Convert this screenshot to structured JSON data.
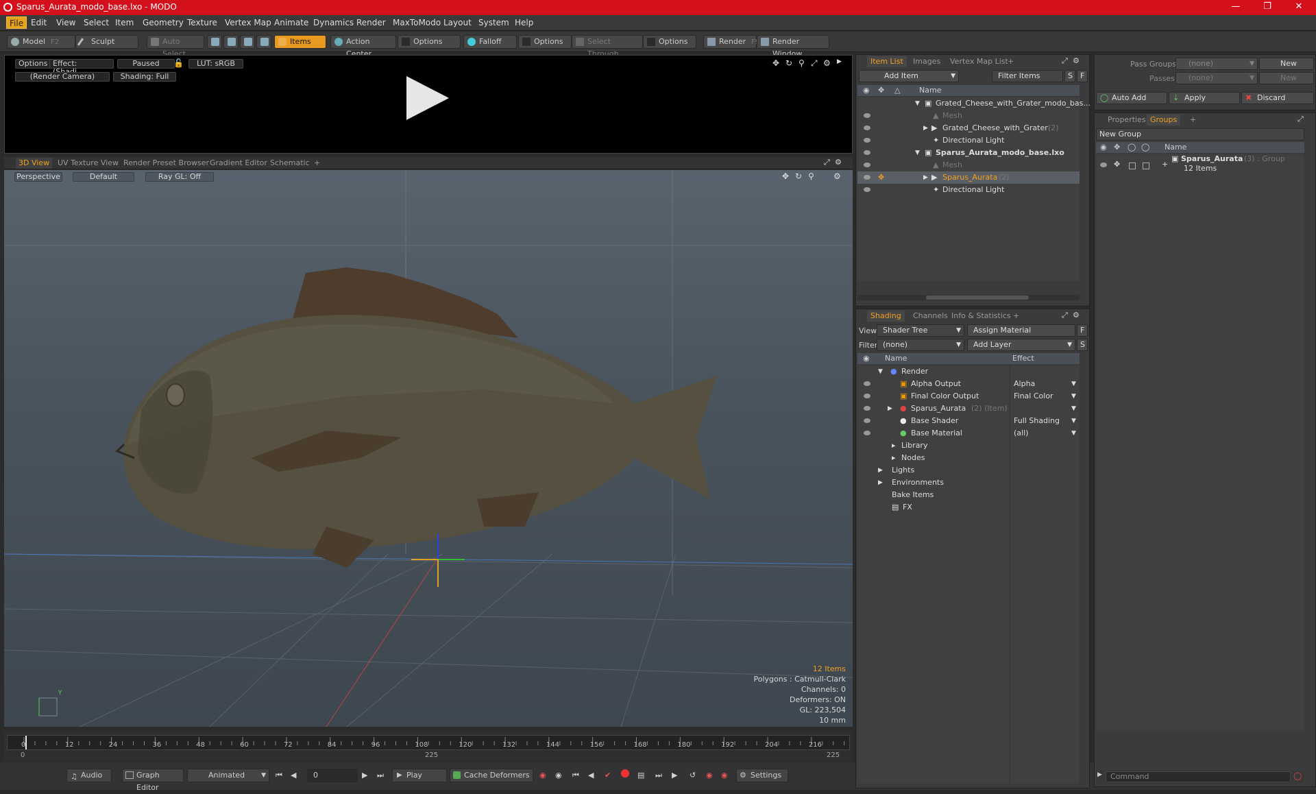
{
  "window": {
    "title": "Sparus_Aurata_modo_base.lxo - MODO"
  },
  "menu": [
    "File",
    "Edit",
    "View",
    "Select",
    "Item",
    "Geometry",
    "Texture",
    "Vertex Map",
    "Animate",
    "Dynamics",
    "Render",
    "MaxToModo",
    "Layout",
    "System",
    "Help"
  ],
  "toolbar": {
    "model": "Model",
    "model_key": "F2",
    "sculpt": "Sculpt",
    "auto_select": "Auto Select",
    "items": "Items",
    "action_center": "Action Center",
    "options1": "Options",
    "falloff": "Falloff",
    "options2": "Options",
    "select_through": "Select Through",
    "options3": "Options",
    "render": "Render",
    "render_key": "F9",
    "render_window": "Render Window"
  },
  "preview": {
    "options": "Options",
    "effect": "Effect: (Shadi...",
    "paused": "Paused",
    "lut": "LUT: sRGB",
    "camera": "(Render Camera)",
    "shading": "Shading: Full"
  },
  "viewport_tabs": [
    "3D View",
    "UV Texture View",
    "Render Preset Browser",
    "Gradient Editor",
    "Schematic",
    "+"
  ],
  "viewport": {
    "perspective": "Perspective",
    "default": "Default",
    "raygl": "Ray GL: Off",
    "axis_y": "Y"
  },
  "hud": {
    "items": "12 Items",
    "polygons": "Polygons : Catmull-Clark",
    "channels": "Channels: 0",
    "deformers": "Deformers: ON",
    "gl": "GL: 223,504",
    "size": "10 mm"
  },
  "timeline": {
    "ticks": [
      "0",
      "12",
      "24",
      "36",
      "48",
      "60",
      "72",
      "84",
      "96",
      "108",
      "120",
      "132",
      "144",
      "156",
      "168",
      "180",
      "192",
      "204",
      "216"
    ],
    "start": "0",
    "mid": "225",
    "end": "225"
  },
  "bottom": {
    "audio": "Audio",
    "graph_editor": "Graph Editor",
    "animated": "Animated",
    "frame": "0",
    "play": "Play",
    "cache": "Cache Deformers",
    "settings": "Settings"
  },
  "item_list": {
    "tabs": [
      "Item List",
      "Images",
      "Vertex Map List",
      "+"
    ],
    "add_item": "Add Item",
    "filter": "Filter Items",
    "s": "S",
    "f": "F",
    "col_name": "Name",
    "rows": [
      {
        "label": "Grated_Cheese_with_Grater_modo_bas...",
        "suffix": ""
      },
      {
        "label": "Mesh",
        "suffix": ""
      },
      {
        "label": "Grated_Cheese_with_Grater",
        "suffix": "(2)"
      },
      {
        "label": "Directional Light",
        "suffix": ""
      },
      {
        "label": "Sparus_Aurata_modo_base.lxo",
        "suffix": ""
      },
      {
        "label": "Mesh",
        "suffix": ""
      },
      {
        "label": "Sparus_Aurata",
        "suffix": "(2)"
      },
      {
        "label": "Directional Light",
        "suffix": ""
      }
    ]
  },
  "shading": {
    "tabs": [
      "Shading",
      "Channels",
      "Info & Statistics",
      "+"
    ],
    "view_label": "View",
    "view_value": "Shader Tree",
    "assign": "Assign Material",
    "f": "F",
    "filter_label": "Filter",
    "filter_value": "(none)",
    "add_layer": "Add Layer",
    "s": "S",
    "col_name": "Name",
    "col_effect": "Effect",
    "rows": [
      {
        "name": "Render",
        "effect": ""
      },
      {
        "name": "Alpha Output",
        "effect": "Alpha"
      },
      {
        "name": "Final Color Output",
        "effect": "Final Color"
      },
      {
        "name": "Sparus_Aurata",
        "extra": "(2) (Item)",
        "effect": ""
      },
      {
        "name": "Base Shader",
        "effect": "Full Shading"
      },
      {
        "name": "Base Material",
        "effect": "(all)"
      },
      {
        "name": "Library",
        "effect": ""
      },
      {
        "name": "Nodes",
        "effect": ""
      },
      {
        "name": "Lights",
        "effect": ""
      },
      {
        "name": "Environments",
        "effect": ""
      },
      {
        "name": "Bake Items",
        "effect": ""
      },
      {
        "name": "FX",
        "effect": ""
      }
    ]
  },
  "passes": {
    "pass_groups": "Pass Groups",
    "passes": "Passes",
    "none1": "(none)",
    "none2": "(none)",
    "new1": "New",
    "new2": "New",
    "auto_add": "Auto Add",
    "apply": "Apply",
    "discard": "Discard"
  },
  "groups": {
    "tabs": [
      "Properties",
      "Groups",
      "+"
    ],
    "new_group": "New Group",
    "col_name": "Name",
    "group_name": "Sparus_Aurata",
    "group_suffix": "(3) : Group",
    "group_count": "12 Items"
  },
  "command": {
    "placeholder": "Command"
  }
}
